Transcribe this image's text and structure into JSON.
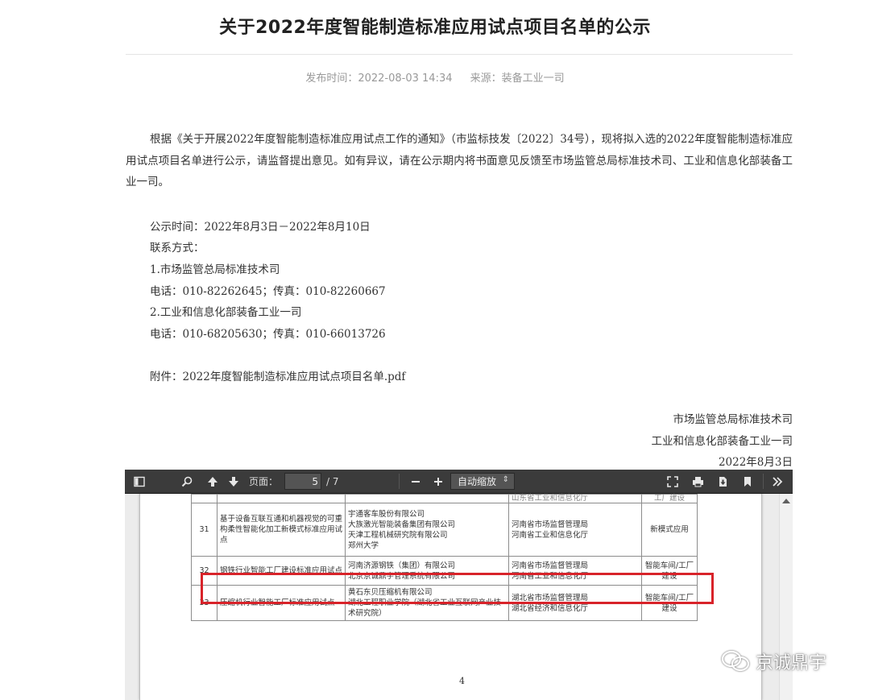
{
  "article": {
    "title": "关于2022年度智能制造标准应用试点项目名单的公示",
    "publish_label": "发布时间：2022-08-03 14:34",
    "source_label": "来源：装备工业一司",
    "intro": "根据《关于开展2022年度智能制造标准应用试点工作的通知》（市监标技发〔2022〕34号），现将拟入选的2022年度智能制造标准应用试点项目名单进行公示，请监督提出意见。如有异议，请在公示期内将书面意见反馈至市场监管总局标准技术司、工业和信息化部装备工业一司。",
    "period": "公示时间：2022年8月3日－2022年8月10日",
    "contact_title": "联系方式：",
    "contact1_name": "1.市场监管总局标准技术司",
    "contact1_phone": "电话：010-82262645；传真：010-82260667",
    "contact2_name": "2.工业和信息化部装备工业一司",
    "contact2_phone": "电话：010-68205630；传真：010-66013726",
    "attachment": "附件：2022年度智能制造标准应用试点项目名单.pdf",
    "signature1": "市场监管总局标准技术司",
    "signature2": "工业和信息化部装备工业一司",
    "date": "2022年8月3日"
  },
  "viewer": {
    "page_label": "页面：",
    "page_current": "5",
    "page_total": "/ 7",
    "zoom_label": "自动缩放",
    "icons": [
      "sidebar-toggle-icon",
      "search-icon",
      "arrow-up-icon",
      "arrow-down-icon",
      "minus-icon",
      "plus-icon",
      "fullscreen-icon",
      "print-icon",
      "download-icon",
      "bookmark-icon",
      "double-chevron-right-icon"
    ]
  },
  "pdf": {
    "cut_top_left": "",
    "cut_top_auth": "山东省工业和信息化厅",
    "cut_top_type": "工厂建设",
    "rows": [
      {
        "num": "31",
        "name": "基于设备互联互通和机器视觉的可重构柔性智能化加工新模式标准应用试点",
        "orgs": [
          "宇通客车股份有限公司",
          "大族激光智能装备集团有限公司",
          "天津工程机械研究院有限公司",
          "郑州大学"
        ],
        "auth": [
          "河南省市场监督管理局",
          "河南省工业和信息化厅"
        ],
        "type": "新模式应用"
      },
      {
        "num": "32",
        "name": "钢铁行业智能工厂建设标准应用试点",
        "orgs": [
          "河南济源钢铁（集团）有限公司",
          "北京京诚鼎宇管理系统有限公司"
        ],
        "auth": [
          "河南省市场监督管理局",
          "河南省工业和信息化厅"
        ],
        "type": "智能车间/工厂建设"
      },
      {
        "num": "33",
        "name": "压缩机行业智能工厂标准应用试点",
        "orgs": [
          "黄石东贝压缩机有限公司",
          "湖北工程职业学院（湖北省工业互联网产业技术研究院）"
        ],
        "auth": [
          "湖北省市场监督管理局",
          "湖北省经济和信息化厅"
        ],
        "type": "智能车间/工厂建设"
      }
    ],
    "page_number": "4"
  },
  "watermark": {
    "text": "京诚鼎宇",
    "icon": "wechat-icon"
  },
  "colors": {
    "highlight": "#d8232a",
    "toolbar": "#3b3b3b"
  }
}
